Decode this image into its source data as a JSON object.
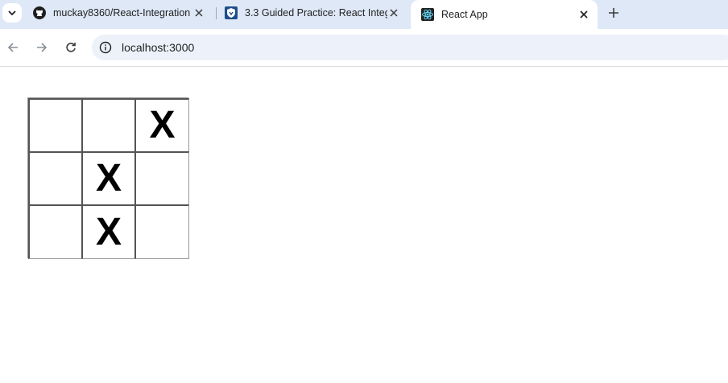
{
  "browser": {
    "tabs": [
      {
        "title": "muckay8360/React-Integration",
        "icon": "github-icon",
        "active": false
      },
      {
        "title": "3.3 Guided Practice: React Integ",
        "icon": "shield-icon",
        "active": false
      },
      {
        "title": "React App",
        "icon": "react-icon",
        "active": true
      }
    ],
    "address": "localhost:3000"
  },
  "board": {
    "squares": [
      "",
      "",
      "X",
      "",
      "X",
      "",
      "",
      "X",
      ""
    ]
  }
}
